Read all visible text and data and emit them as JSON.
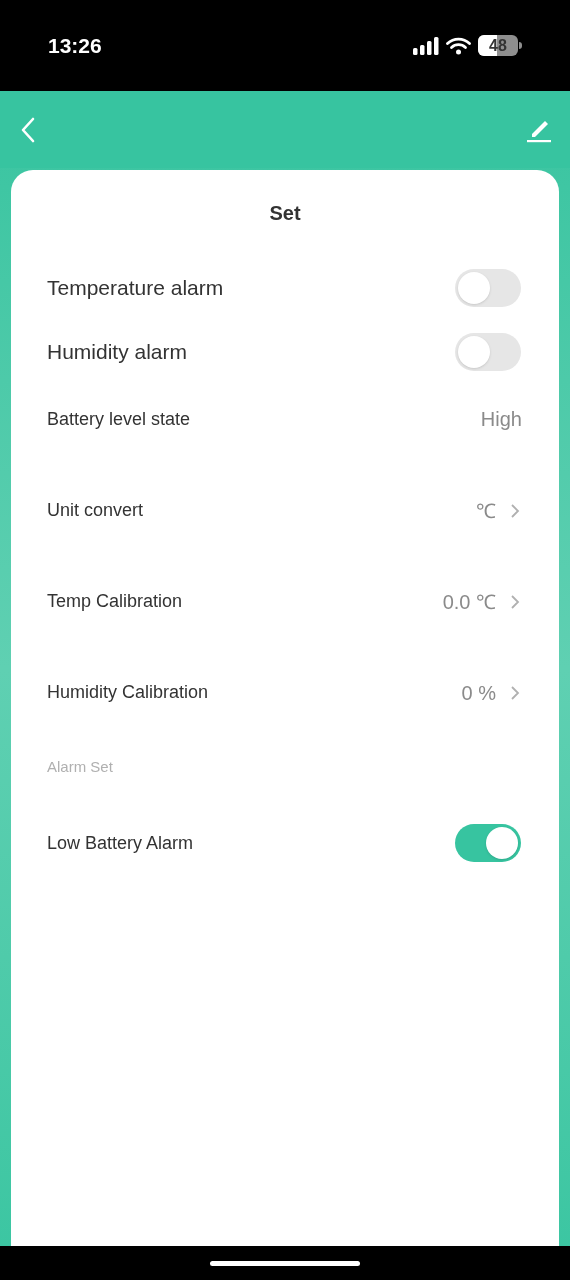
{
  "status_bar": {
    "time": "13:26",
    "battery": "48"
  },
  "card": {
    "title": "Set"
  },
  "items": [
    {
      "kind": "toggle",
      "label": "Temperature alarm",
      "on": false
    },
    {
      "kind": "toggle",
      "label": "Humidity alarm",
      "on": false
    },
    {
      "kind": "value",
      "label": "Battery level state",
      "value": "High"
    },
    {
      "kind": "link",
      "label": "Unit convert",
      "value": "℃"
    },
    {
      "kind": "link",
      "label": "Temp Calibration",
      "value": "0.0 ℃"
    },
    {
      "kind": "link",
      "label": "Humidity Calibration",
      "value": "0 %"
    },
    {
      "kind": "section",
      "label": "Alarm Set"
    },
    {
      "kind": "toggle",
      "label": "Low Battery Alarm",
      "on": true
    }
  ]
}
